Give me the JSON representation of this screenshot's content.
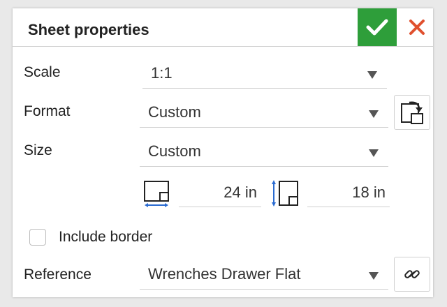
{
  "dialog": {
    "title": "Sheet properties",
    "ok_icon": "checkmark-icon",
    "close_icon": "close-icon"
  },
  "scale": {
    "label": "Scale",
    "value": "1:1"
  },
  "format": {
    "label": "Format",
    "value": "Custom",
    "button_icon": "apply-format-icon"
  },
  "size": {
    "label": "Size",
    "value": "Custom",
    "width_icon": "sheet-width-icon",
    "width": "24 in",
    "height_icon": "sheet-height-icon",
    "height": "18 in"
  },
  "border": {
    "label": "Include border",
    "checked": false
  },
  "reference": {
    "label": "Reference",
    "value": "Wrenches Drawer Flat",
    "button_icon": "link-icon"
  },
  "colors": {
    "accept": "#2e9e3a",
    "close": "#e0502e",
    "dimension_arrow": "#2a6bd1"
  }
}
